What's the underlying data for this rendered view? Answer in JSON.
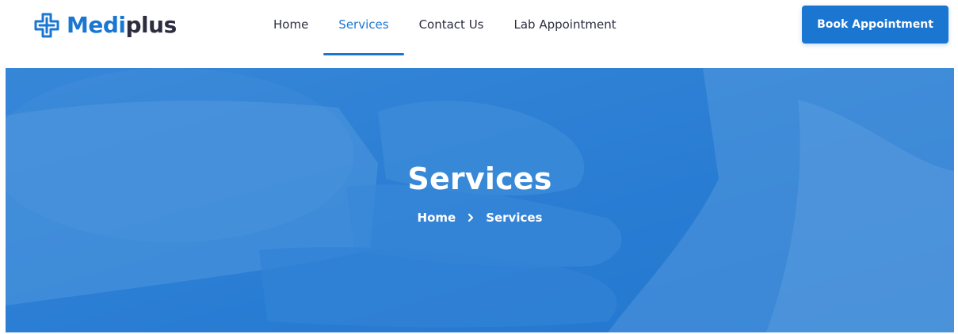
{
  "brand": {
    "name_part1": "Medi",
    "name_part2": "plus",
    "primary_color": "#1a76d1",
    "dark_color": "#2c2d3f",
    "logo_icon": "medical-cross-icon"
  },
  "nav": {
    "items": [
      {
        "label": "Home",
        "active": false
      },
      {
        "label": "Services",
        "active": true
      },
      {
        "label": "Contact Us",
        "active": false
      },
      {
        "label": "Lab Appointment",
        "active": false
      }
    ]
  },
  "header": {
    "cta_label": "Book Appointment"
  },
  "hero": {
    "title": "Services",
    "breadcrumb": {
      "home_label": "Home",
      "separator_icon": "chevron-right-icon",
      "current_label": "Services"
    },
    "overlay_color": "#1a76d1"
  }
}
